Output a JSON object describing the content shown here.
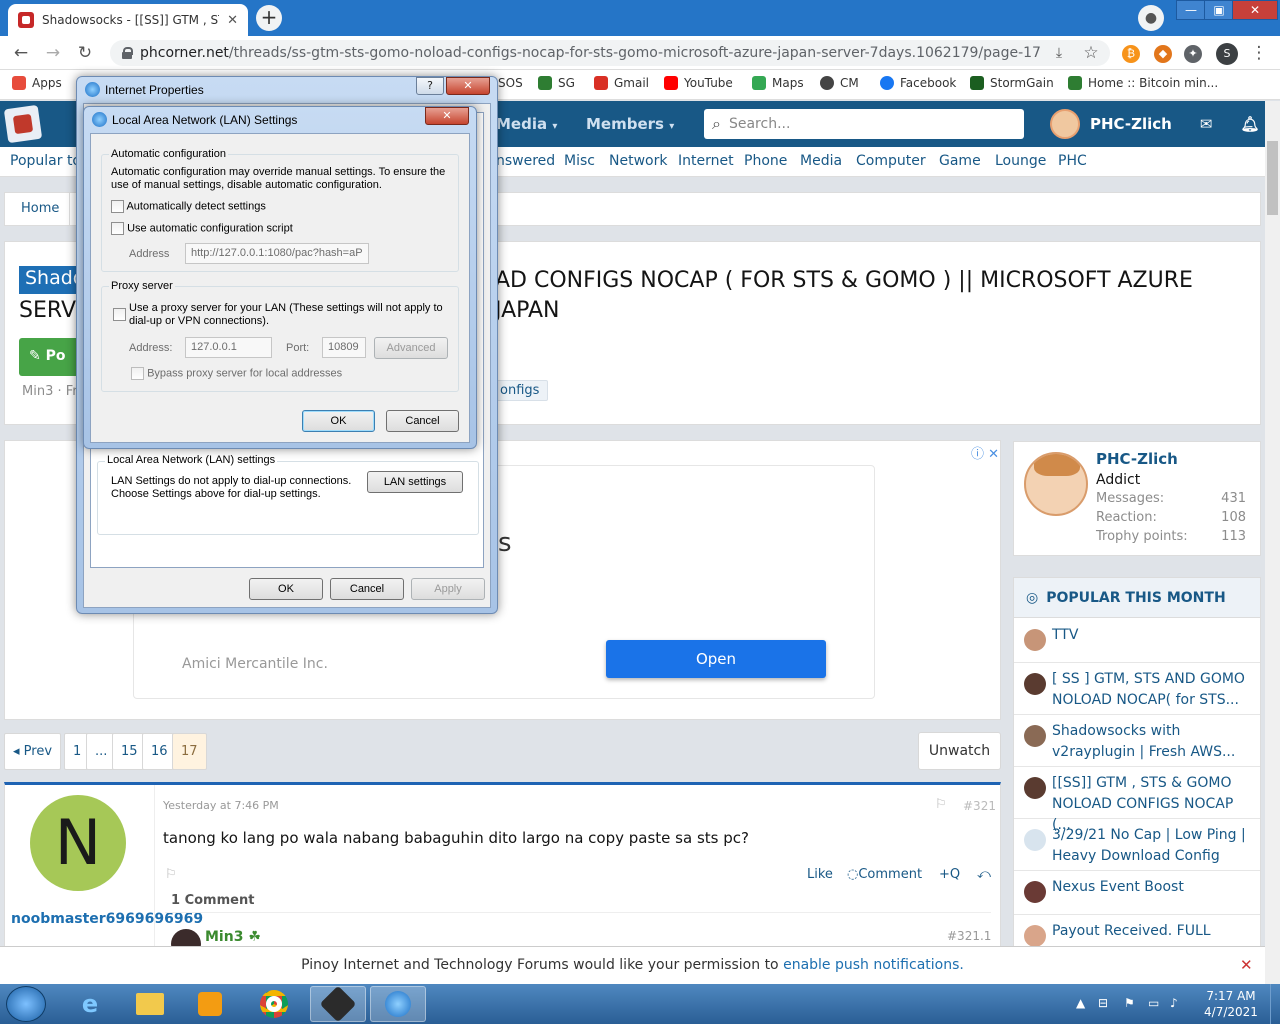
{
  "browser": {
    "tab_title": "Shadowsocks - [[SS]] GTM , STS &",
    "tab_close": "✕",
    "new_tab": "+",
    "url_domain": "phcorner.net",
    "url_path": "/threads/ss-gtm-sts-gomo-noload-configs-nocap-for-sts-gomo-microsoft-azure-japan-server-7days.1062179/page-17",
    "profile_initial": "S",
    "window_min": "—",
    "window_max": "▣",
    "window_close": "✕"
  },
  "bookmarks": [
    {
      "label": "Apps",
      "color": "#e74c3c"
    },
    {
      "label": "SOS",
      "color": "#888888"
    },
    {
      "label": "SG",
      "color": "#2e7d32"
    },
    {
      "label": "Gmail",
      "color": "#d93025"
    },
    {
      "label": "YouTube",
      "color": "#ff0000"
    },
    {
      "label": "Maps",
      "color": "#34a853"
    },
    {
      "label": "CM",
      "color": "#444444"
    },
    {
      "label": "Facebook",
      "color": "#1877f2"
    },
    {
      "label": "StormGain",
      "color": "#1b5e20"
    },
    {
      "label": "Home :: Bitcoin min...",
      "color": "#2e7d32"
    }
  ],
  "site": {
    "nav": [
      "Media",
      "Members"
    ],
    "search_placeholder": "Search...",
    "username": "PHC-Zlich",
    "subnav_first": "Popular to",
    "subnav": [
      "nswered",
      "Misc",
      "Network",
      "Internet",
      "Phone",
      "Media",
      "Computer",
      "Game",
      "Lounge",
      "PHC"
    ],
    "breadcrumb_home": "Home"
  },
  "thread": {
    "prefix": "Shado",
    "title": "AD CONFIGS NOCAP ( FOR STS & GOMO ) || MICROSOFT AZURE JAPAN",
    "title_line2": "SERVE",
    "post_button": "Po",
    "meta": "Min3 · Fr",
    "tag": "onfigs"
  },
  "ad": {
    "fragment": "s",
    "company": "Amici Mercantile Inc.",
    "open_button": "Open",
    "adchoices": "ⓘ ✕"
  },
  "profile": {
    "name": "PHC-Zlich",
    "rank": "Addict",
    "stats": [
      {
        "label": "Messages:",
        "value": "431"
      },
      {
        "label": "Reaction:",
        "value": "108"
      },
      {
        "label": "Trophy points:",
        "value": "113"
      }
    ]
  },
  "popular": {
    "header": "POPULAR THIS MONTH",
    "items": [
      "TTV",
      "[ SS ] GTM, STS AND GOMO NOLOAD NOCAP( for STS...",
      "Shadowsocks with v2rayplugin | Fresh AWS...",
      "[[SS]] GTM , STS & GOMO NOLOAD CONFIGS NOCAP (...",
      "3/29/21 No Cap | Low Ping | Heavy Download Config",
      "Nexus Event Boost",
      "Payout Received. FULL"
    ]
  },
  "pagination": {
    "prev": "◂ Prev",
    "pages": [
      "1",
      "...",
      "15",
      "16",
      "17"
    ],
    "unwatch": "Unwatch"
  },
  "post": {
    "avatar_letter": "N",
    "author": "noobmaster6969696969",
    "date": "Yesterday at 7:46 PM",
    "number": "#321",
    "text": "tanong ko lang po wala nabang babaguhin dito largo na copy paste sa sts pc?",
    "actions": {
      "like": "Like",
      "comment": "Comment",
      "quote": "+Q",
      "reply": "⤺"
    },
    "comment_count": "1 Comment",
    "reply_user": "Min3",
    "reply_number": "#321.1"
  },
  "notification": {
    "prefix": "Pinoy Internet and Technology Forums would like your permission to",
    "link": "enable push notifications."
  },
  "internet_properties": {
    "title": "Internet Properties",
    "help": "?",
    "close": "✕",
    "lan_group": "Local Area Network (LAN) settings",
    "lan_desc": "LAN Settings do not apply to dial-up connections. Choose Settings above for dial-up settings.",
    "lan_button": "LAN settings",
    "ok": "OK",
    "cancel": "Cancel",
    "apply": "Apply"
  },
  "lan_dialog": {
    "title": "Local Area Network (LAN) Settings",
    "close": "✕",
    "auto_group": "Automatic configuration",
    "auto_desc": "Automatic configuration may override manual settings.  To ensure the use of manual settings, disable automatic configuration.",
    "auto_detect": "Automatically detect settings",
    "auto_script": "Use automatic configuration script",
    "address_label": "Address",
    "address_value": "http://127.0.0.1:1080/pac?hash=aP",
    "proxy_group": "Proxy server",
    "proxy_use": "Use a proxy server for your LAN (These settings will not apply to dial-up or VPN connections).",
    "proxy_address_label": "Address:",
    "proxy_address": "127.0.0.1",
    "port_label": "Port:",
    "port": "10809",
    "advanced": "Advanced",
    "bypass": "Bypass proxy server for local addresses",
    "ok": "OK",
    "cancel": "Cancel"
  },
  "taskbar": {
    "time": "7:17 AM",
    "date": "4/7/2021"
  }
}
